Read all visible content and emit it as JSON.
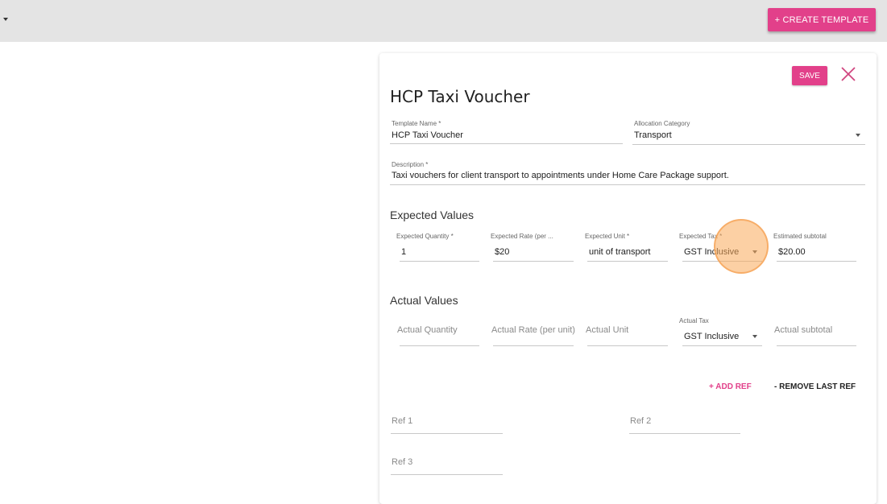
{
  "toolbar": {
    "create_label": "+ CREATE TEMPLATE"
  },
  "card": {
    "save_label": "SAVE",
    "title": "HCP Taxi Voucher",
    "template_name": {
      "label": "Template Name *",
      "value": "HCP Taxi Voucher"
    },
    "allocation_category": {
      "label": "Allocation Category",
      "value": "Transport"
    },
    "description": {
      "label": "Description *",
      "value": "Taxi vouchers for client transport to appointments under Home Care Package support."
    },
    "expected": {
      "heading": "Expected Values",
      "quantity": {
        "label": "Expected Quantity *",
        "value": "1"
      },
      "rate": {
        "label": "Expected Rate (per ...",
        "value": "$20"
      },
      "unit": {
        "label": "Expected Unit *",
        "value": "unit of transport"
      },
      "tax": {
        "label": "Expected Tax *",
        "value": "GST Inclusive"
      },
      "subtotal": {
        "label": "Estimated subtotal",
        "value": "$20.00"
      }
    },
    "actual": {
      "heading": "Actual Values",
      "quantity_placeholder": "Actual Quantity",
      "rate_placeholder": "Actual Rate (per unit)",
      "unit_placeholder": "Actual Unit",
      "tax": {
        "label": "Actual Tax",
        "value": "GST Inclusive"
      },
      "subtotal_placeholder": "Actual subtotal"
    },
    "refs": {
      "add_label": "+ ADD REF",
      "remove_label": "- REMOVE LAST REF",
      "ref1_placeholder": "Ref 1",
      "ref2_placeholder": "Ref 2",
      "ref3_placeholder": "Ref 3"
    }
  },
  "colors": {
    "accent": "#e2408a",
    "topbar": "#e4e4e4",
    "focus_highlight": "#f8aa5a"
  },
  "icons": {
    "close": "close-icon",
    "dropdown": "chevron-down-icon"
  }
}
